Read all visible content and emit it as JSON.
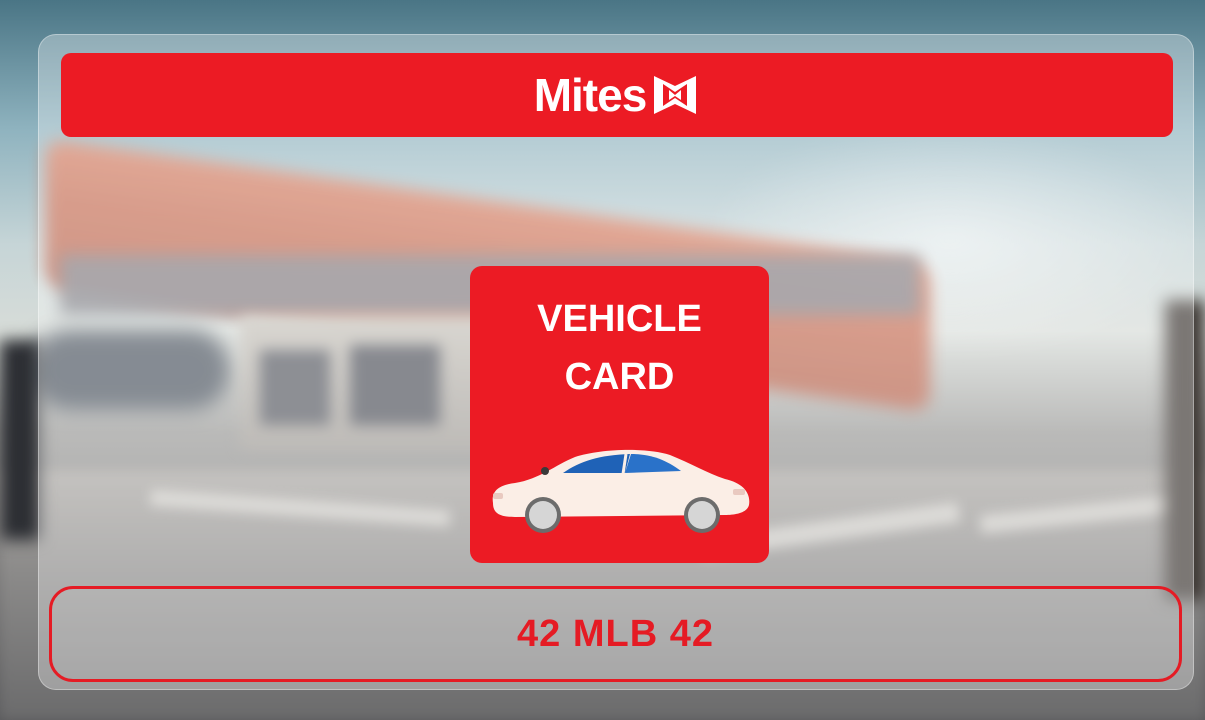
{
  "brand": {
    "name": "Mites",
    "color": "#EC1B24",
    "logo_icon": "mites-m-logo-icon"
  },
  "card": {
    "title_line1": "VEHICLE",
    "title_line2": "CARD",
    "icon": "car-icon"
  },
  "plate": {
    "number": "42 MLB 42"
  },
  "background": {
    "description_icon": "gas-station-background"
  }
}
